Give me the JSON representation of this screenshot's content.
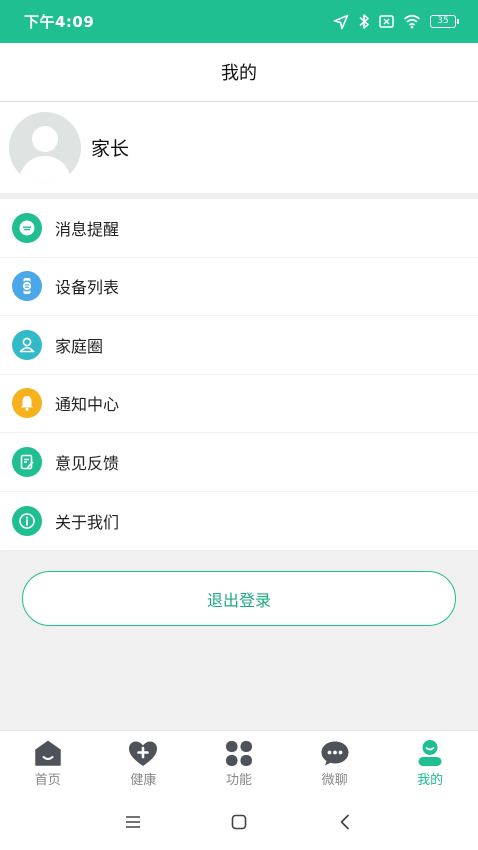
{
  "status_bar": {
    "time": "下午4:09",
    "battery": "35"
  },
  "header": {
    "title": "我的"
  },
  "profile": {
    "name": "家长"
  },
  "menu": [
    {
      "label": "消息提醒",
      "icon": "message-icon",
      "color": "#1fbf91"
    },
    {
      "label": "设备列表",
      "icon": "watch-icon",
      "color": "#4aa8e8"
    },
    {
      "label": "家庭圈",
      "icon": "family-icon",
      "color": "#34b9c8"
    },
    {
      "label": "通知中心",
      "icon": "bell-icon",
      "color": "#f5b21d"
    },
    {
      "label": "意见反馈",
      "icon": "feedback-icon",
      "color": "#1fbf91"
    },
    {
      "label": "关于我们",
      "icon": "info-icon",
      "color": "#1fbf91"
    }
  ],
  "logout_label": "退出登录",
  "tabs": [
    {
      "label": "首页",
      "icon": "home-icon",
      "active": false
    },
    {
      "label": "健康",
      "icon": "health-icon",
      "active": false
    },
    {
      "label": "功能",
      "icon": "functions-icon",
      "active": false
    },
    {
      "label": "微聊",
      "icon": "chat-icon",
      "active": false
    },
    {
      "label": "我的",
      "icon": "profile-icon",
      "active": true
    }
  ],
  "colors": {
    "accent": "#1fbf91",
    "inactive": "#4d5358",
    "background": "#f0f0f0"
  }
}
